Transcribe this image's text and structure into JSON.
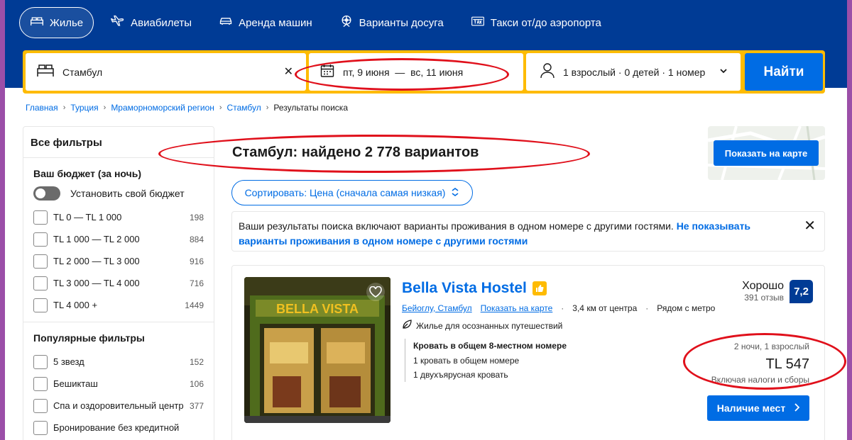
{
  "nav": {
    "tabs": [
      {
        "label": "Жилье",
        "icon": "bed-icon"
      },
      {
        "label": "Авиабилеты",
        "icon": "plane-icon"
      },
      {
        "label": "Аренда машин",
        "icon": "car-icon"
      },
      {
        "label": "Варианты досуга",
        "icon": "attractions-icon"
      },
      {
        "label": "Такси от/до аэропорта",
        "icon": "taxi-icon"
      }
    ]
  },
  "search": {
    "destination": "Стамбул",
    "dates": "пт, 9 июня  —  вс, 11 июня",
    "guests": "1 взрослый · 0 детей · 1 номер",
    "submit_label": "Найти"
  },
  "breadcrumbs": [
    "Главная",
    "Турция",
    "Мраморноморский регион",
    "Стамбул",
    "Результаты поиска"
  ],
  "sidebar": {
    "title": "Все фильтры",
    "budget": {
      "heading": "Ваш бюджет (за ночь)",
      "toggle_label": "Установить свой бюджет",
      "ranges": [
        {
          "label": "TL 0 — TL 1 000",
          "count": "198"
        },
        {
          "label": "TL 1 000 — TL 2 000",
          "count": "884"
        },
        {
          "label": "TL 2 000 — TL 3 000",
          "count": "916"
        },
        {
          "label": "TL 3 000 — TL 4 000",
          "count": "716"
        },
        {
          "label": "TL 4 000 +",
          "count": "1449"
        }
      ]
    },
    "popular": {
      "heading": "Популярные фильтры",
      "items": [
        {
          "label": "5 звезд",
          "count": "152"
        },
        {
          "label": "Бешикташ",
          "count": "106"
        },
        {
          "label": "Спа и оздоровительный центр",
          "count": "377"
        },
        {
          "label": "Бронирование без кредитной",
          "count": ""
        }
      ]
    }
  },
  "results": {
    "title": "Стамбул: найдено 2 778 вариантов",
    "map_button": "Показать на карте",
    "sort_label": "Сортировать: Цена (сначала самая низкая)",
    "notice_text": "Ваши результаты поиска включают варианты проживания в одном номере с другими гостями. ",
    "notice_link": "Не показывать варианты проживания в одном номере с другими гостями"
  },
  "card": {
    "photo_sign": "BELLA VISTA",
    "name": "Bella Vista Hostel",
    "district": "Бейоглу, Стамбул",
    "map_link": "Показать на карте",
    "distance": "3,4 км от центра",
    "metro": "Рядом с метро",
    "eco_label": "Жилье для осознанных путешествий",
    "room_title": "Кровать в общем 8-местном номере",
    "room_line1": "1 кровать в общем номере",
    "room_line2": "1 двухъярусная кровать",
    "rating_word": "Хорошо",
    "reviews": "391 отзыв",
    "score": "7,2",
    "stay": "2 ночи, 1 взрослый",
    "price": "TL 547",
    "taxes": "Включая налоги и сборы",
    "avail_button": "Наличие мест"
  },
  "colors": {
    "brand_dark": "#003b95",
    "brand_blue": "#006ce4",
    "search_border": "#febb02",
    "annotation": "#e0101b",
    "frame": "#9b4fa8"
  }
}
